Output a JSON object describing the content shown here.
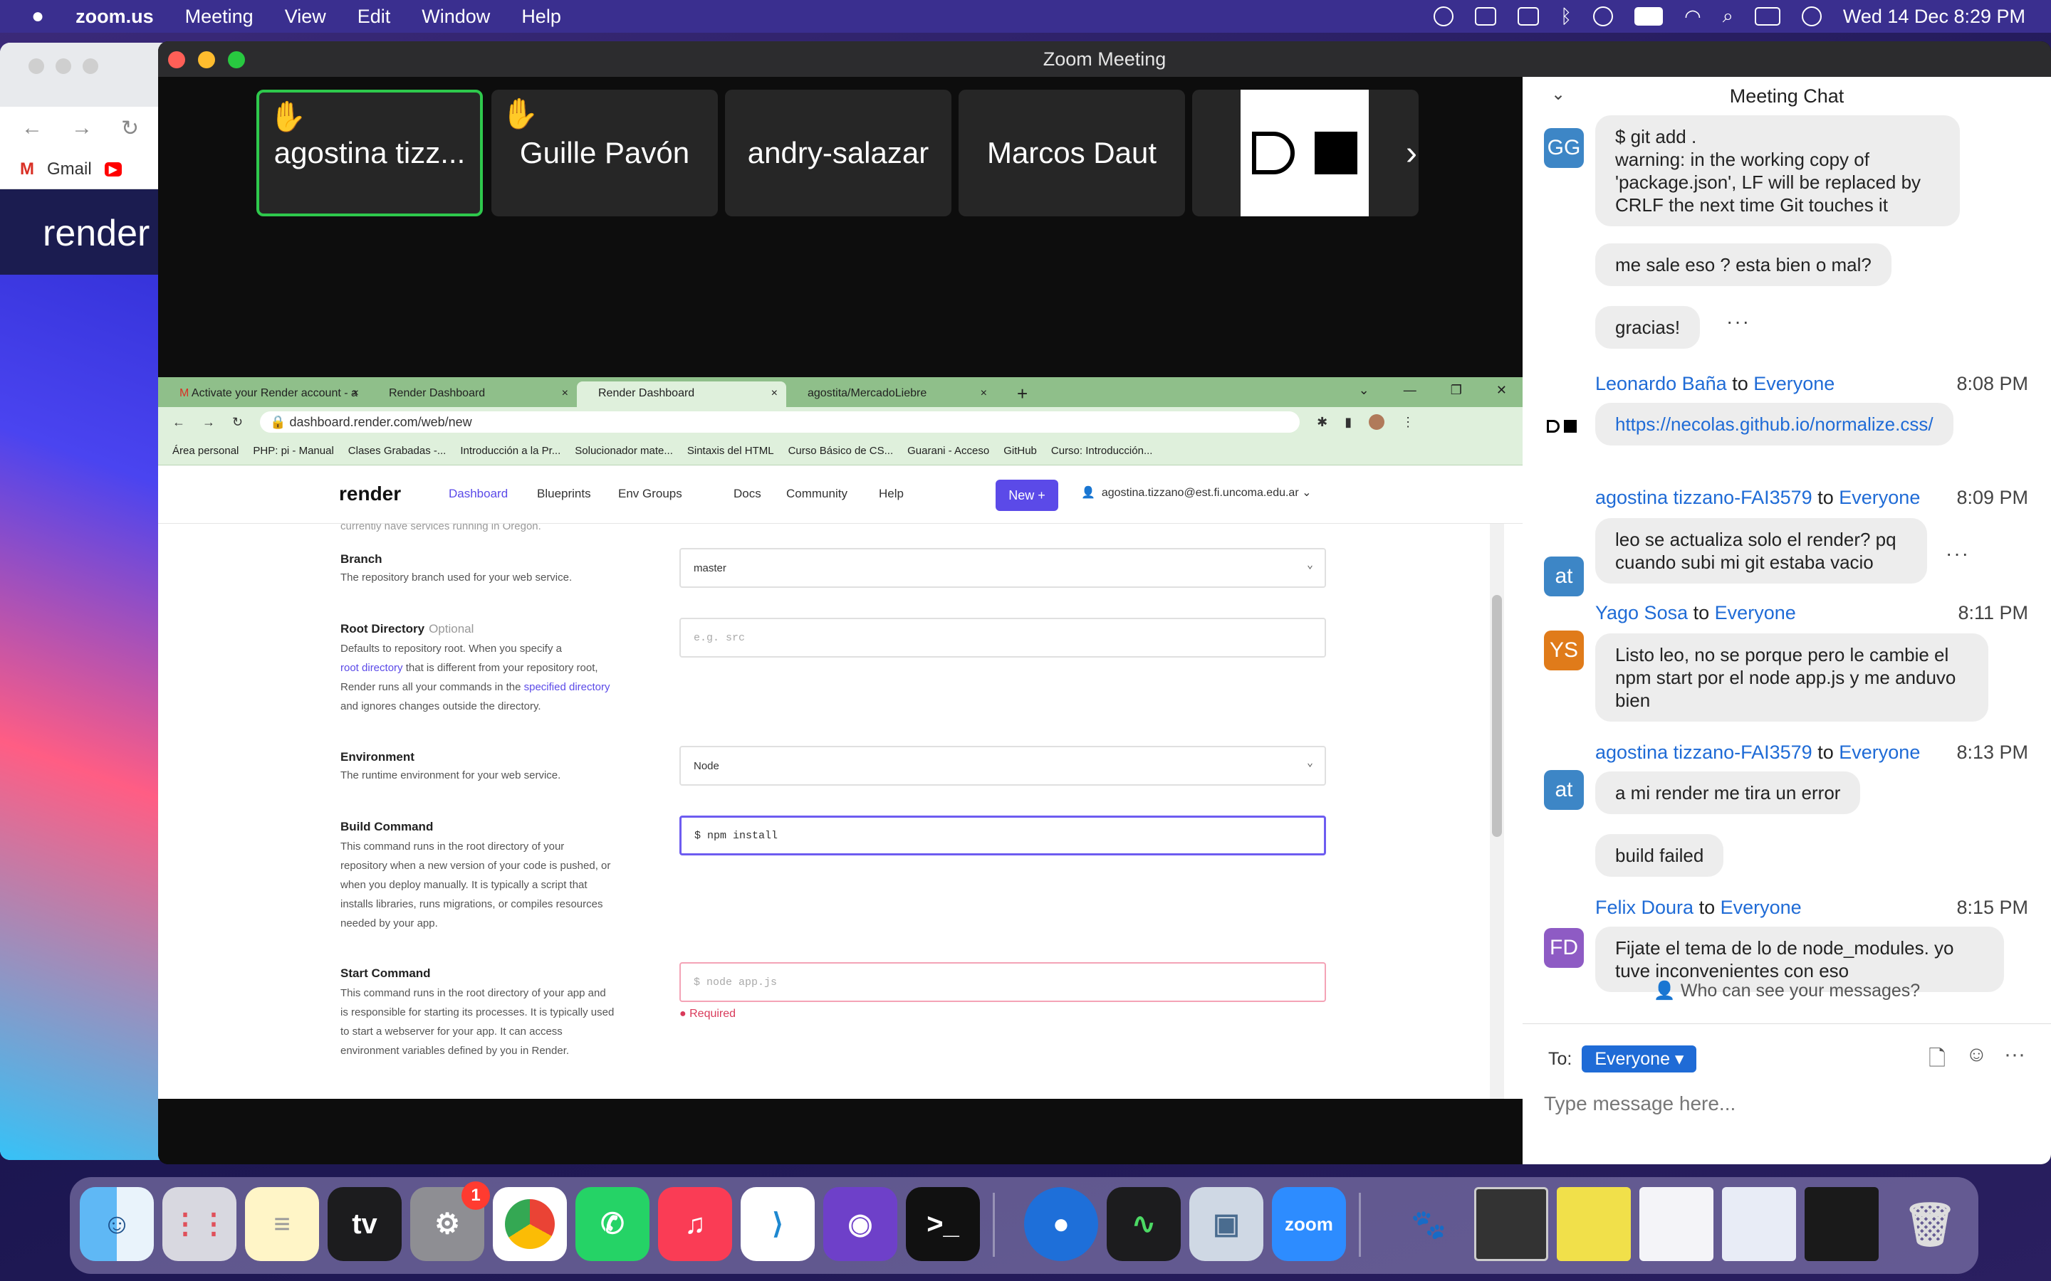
{
  "menubar": {
    "app": "zoom.us",
    "items": [
      "Meeting",
      "View",
      "Edit",
      "Window",
      "Help"
    ],
    "datetime": "Wed 14 Dec  8:29 PM"
  },
  "bg_browser": {
    "bookmark_gmail": "Gmail",
    "site_logo": "render"
  },
  "zoom": {
    "window_title": "Zoom Meeting",
    "participants": [
      {
        "name": "agostina tizz...",
        "hand": "✋"
      },
      {
        "name": "Guille Pavón",
        "hand": "✋"
      },
      {
        "name": "andry-salazar"
      },
      {
        "name": "Marcos Daut"
      }
    ]
  },
  "shared": {
    "tabs": [
      "Activate your Render account - a",
      "Render Dashboard",
      "Render Dashboard",
      "agostita/MercadoLiebre"
    ],
    "url": "dashboard.render.com/web/new",
    "bookmarks": [
      "Área personal",
      "PHP: pi - Manual",
      "Clases Grabadas -...",
      "Introducción a la Pr...",
      "Solucionador mate...",
      "Sintaxis del HTML",
      "Curso Básico de CS...",
      "Guarani - Acceso",
      "GitHub",
      "Curso: Introducción..."
    ],
    "render_logo": "render",
    "nav": [
      "Dashboard",
      "Blueprints",
      "Env Groups",
      "Docs",
      "Community",
      "Help"
    ],
    "new_button": "New +",
    "user_email": "agostina.tizzano@est.fi.uncoma.edu.ar",
    "cutoff_text": "currently have services running in Oregon.",
    "branch": {
      "label": "Branch",
      "desc": "The repository branch used for your web service.",
      "value": "master"
    },
    "root": {
      "label": "Root Directory",
      "optional": "Optional",
      "desc1": "Defaults to repository root. When you specify a",
      "desc2a": "root directory",
      "desc2b": " that is different from your repository root,",
      "desc3a": "Render runs all your commands in the ",
      "desc3b": "specified directory",
      "desc4": "and ignores changes outside the directory.",
      "placeholder": "e.g. src"
    },
    "env": {
      "label": "Environment",
      "desc": "The runtime environment for your web service.",
      "value": "Node"
    },
    "build": {
      "label": "Build Command",
      "desc": [
        "This command runs in the root directory of your",
        "repository when a new version of your code is pushed, or",
        "when you deploy manually. It is typically a script that",
        "installs libraries, runs migrations, or compiles resources",
        "needed by your app."
      ],
      "value": "$ npm install"
    },
    "start": {
      "label": "Start Command",
      "desc": [
        "This command runs in the root directory of your app and",
        "is responsible for starting its processes. It is typically used",
        "to start a webserver for your app. It can access",
        "environment variables defined by you in Render."
      ],
      "placeholder": "$ node app.js",
      "error": "Required"
    }
  },
  "chat": {
    "title": "Meeting Chat",
    "m1": {
      "avatar": "GG",
      "text": "$ git add .\nwarning: in the working copy of 'package.json', LF will be replaced by CRLF the next time Git touches it"
    },
    "m2": {
      "text": "me sale eso ? esta bien o mal?"
    },
    "m3": {
      "text": "gracias!"
    },
    "m4": {
      "sender": "Leonardo Baña",
      "to": "to",
      "target": "Everyone",
      "time": "8:08 PM",
      "text": "https://necolas.github.io/normalize.css/"
    },
    "m5": {
      "avatar": "at",
      "sender": "agostina tizzano-FAI3579",
      "to": "to",
      "target": "Everyone",
      "time": "8:09 PM",
      "text": "leo se actualiza solo el render? pq cuando subi mi git estaba vacio"
    },
    "m6": {
      "avatar": "YS",
      "sender": "Yago Sosa",
      "to": "to",
      "target": "Everyone",
      "time": "8:11 PM",
      "text": "Listo leo, no se porque pero le cambie el npm start por el node app.js y me anduvo bien"
    },
    "m7": {
      "avatar": "at",
      "sender": "agostina tizzano-FAI3579",
      "to": "to",
      "target": "Everyone",
      "time": "8:13 PM",
      "text": "a mi render me tira un error"
    },
    "m8": {
      "text": "build failed"
    },
    "m9": {
      "avatar": "FD",
      "sender": "Felix Doura",
      "to": "to",
      "target": "Everyone",
      "time": "8:15 PM",
      "text": "Fijate el tema de lo de node_modules. yo tuve inconvenientes con eso"
    },
    "who_can_see": "Who can see your messages?",
    "to_label": "To:",
    "to_value": "Everyone",
    "input_placeholder": "Type message here..."
  },
  "dock": {
    "settings_badge": "1",
    "zoom_label": "zoom"
  },
  "colors": {
    "accent": "#5b4ae8",
    "chat_link": "#1f6bd6",
    "active_tile": "#2ec84c",
    "error": "#d93a5a"
  }
}
